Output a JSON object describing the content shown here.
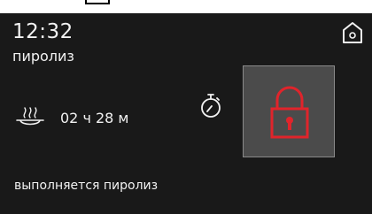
{
  "header": {
    "time": "12:32",
    "mode": "пиролиз"
  },
  "program": {
    "duration": "02 ч 28 м"
  },
  "status": {
    "text": "выполняется пиролиз"
  },
  "icons": {
    "home": "home-icon",
    "steam": "steam-icon",
    "timer": "stopwatch-icon",
    "lock": "lock-icon",
    "top_fragment": "icon-fragment"
  },
  "colors": {
    "background": "#191919",
    "text": "#f2f2f2",
    "lock_accent": "#e0242b",
    "tile": "#4b4b4b"
  }
}
